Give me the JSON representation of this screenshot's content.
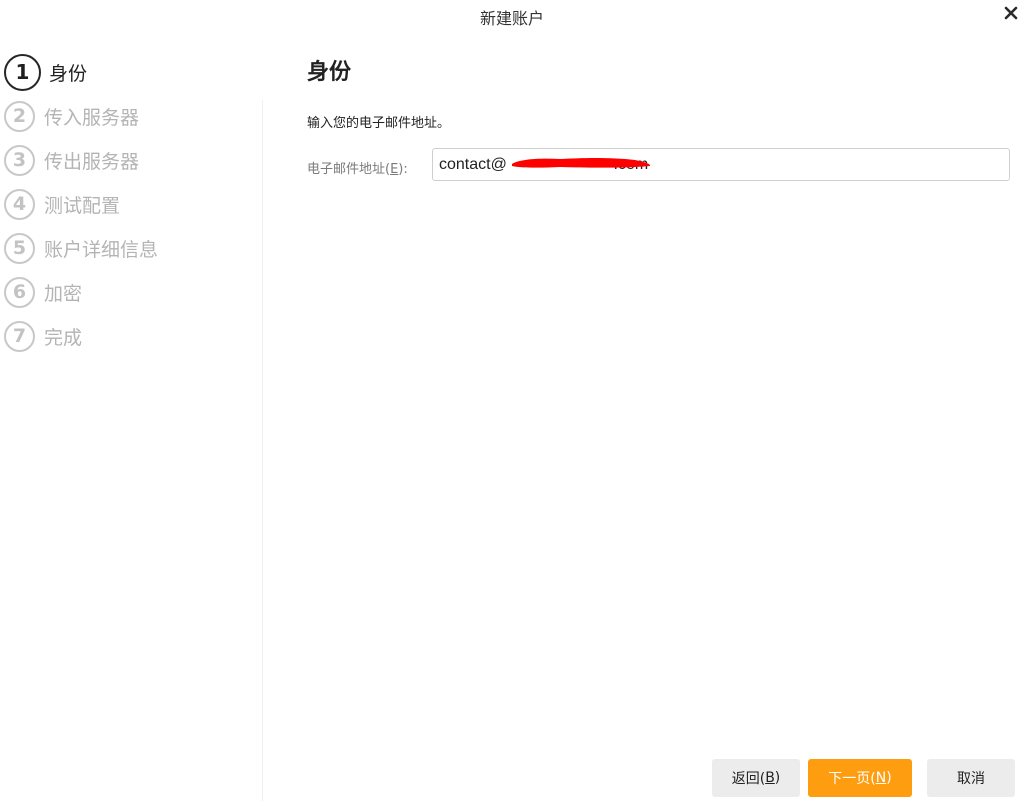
{
  "window": {
    "title": "新建账户"
  },
  "steps": [
    {
      "number": "1",
      "label": "身份",
      "state": "active"
    },
    {
      "number": "2",
      "label": "传入服务器",
      "state": "inactive"
    },
    {
      "number": "3",
      "label": "传出服务器",
      "state": "inactive"
    },
    {
      "number": "4",
      "label": "测试配置",
      "state": "inactive"
    },
    {
      "number": "5",
      "label": "账户详细信息",
      "state": "inactive"
    },
    {
      "number": "6",
      "label": "加密",
      "state": "inactive"
    },
    {
      "number": "7",
      "label": "完成",
      "state": "inactive"
    }
  ],
  "content": {
    "heading": "身份",
    "instruction": "输入您的电子邮件地址。",
    "email_label": "电子邮件地址(",
    "email_label_key": "E",
    "email_label_end": "):",
    "email_value": "contact@                        .com"
  },
  "buttons": {
    "back": "返回(",
    "back_key": "B",
    "back_end": ")",
    "next": "下一页(",
    "next_key": "N",
    "next_end": ")",
    "cancel": "取消"
  },
  "colors": {
    "accent": "#ff9d10",
    "redaction": "#ff0000",
    "inactive_step": "#b4b4b4"
  },
  "icons": {
    "close": "close-icon"
  }
}
